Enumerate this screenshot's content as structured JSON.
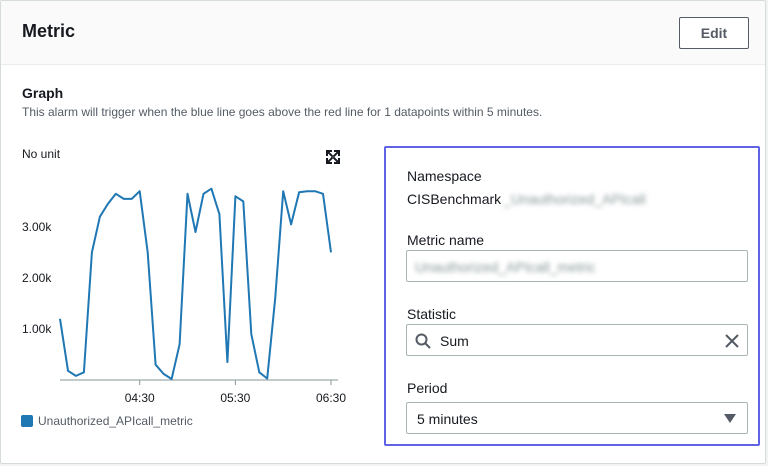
{
  "header": {
    "title": "Metric",
    "edit_label": "Edit"
  },
  "graph": {
    "title": "Graph",
    "description": "This alarm will trigger when the blue line goes above the red line for 1 datapoints within 5 minutes.",
    "unit": "No unit"
  },
  "chart_data": {
    "type": "line",
    "title": "",
    "xlabel": "",
    "ylabel": "No unit",
    "x_ticks": [
      "04:30",
      "05:30",
      "06:30"
    ],
    "y_ticks": [
      "1.00k",
      "2.00k",
      "3.00k"
    ],
    "ylim": [
      0,
      3900
    ],
    "grid": false,
    "legend": "bottom-left",
    "series_color": "#1f77b4",
    "series": [
      {
        "name": "Unauthorized_APIcall_metric",
        "values": [
          1200,
          180,
          80,
          150,
          2500,
          3200,
          3450,
          3650,
          3550,
          3550,
          3700,
          2500,
          300,
          120,
          20,
          700,
          3650,
          2900,
          3650,
          3750,
          3250,
          350,
          3600,
          3500,
          900,
          150,
          30,
          1600,
          3700,
          3050,
          3680,
          3700,
          3700,
          3650,
          2500
        ]
      }
    ],
    "x_tick_positions": [
      10,
      22,
      34
    ]
  },
  "details": {
    "namespace_label": "Namespace",
    "namespace_value": "CISBenchmark",
    "namespace_redacted": "_Unauthorized_APIcall",
    "metric_name_label": "Metric name",
    "metric_name_value": "Unauthorized_APIcall_metric",
    "statistic_label": "Statistic",
    "statistic_value": "Sum",
    "period_label": "Period",
    "period_value": "5 minutes"
  }
}
